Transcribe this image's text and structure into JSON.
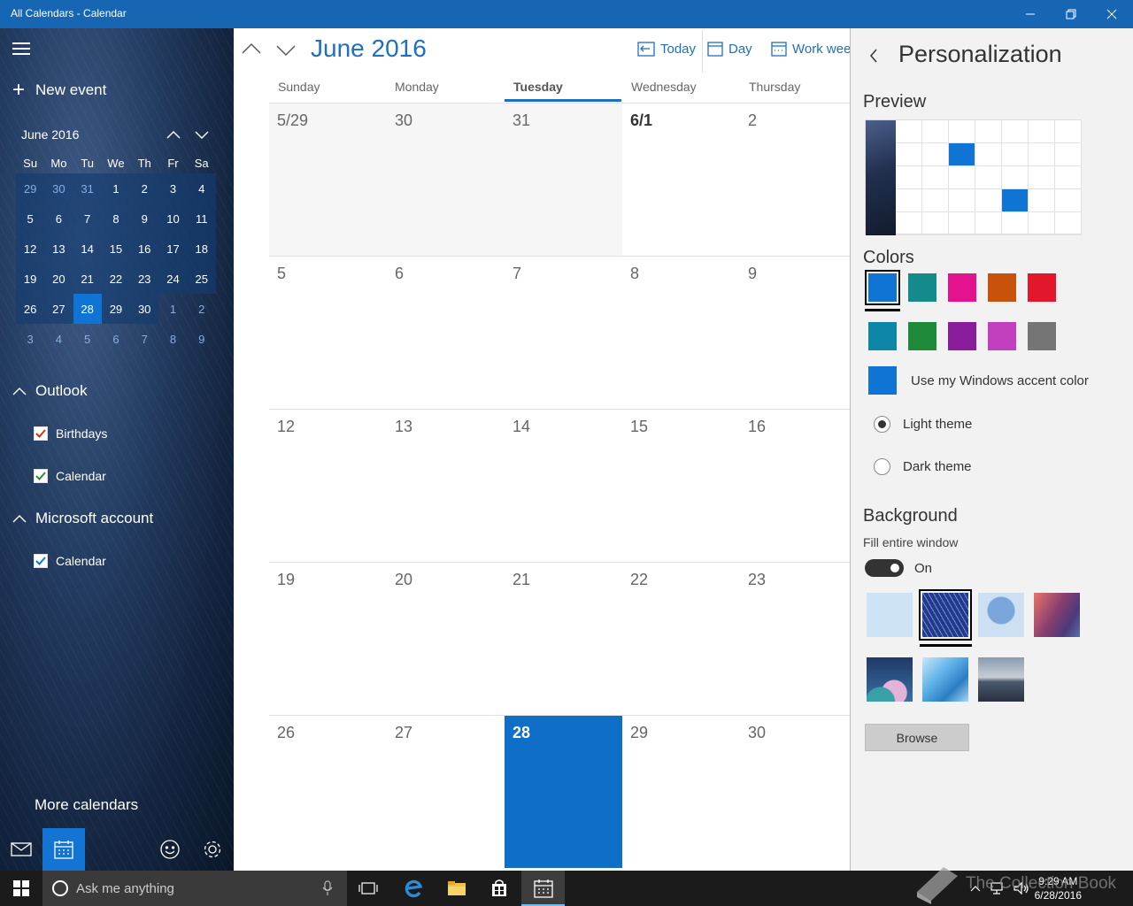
{
  "window": {
    "title": "All Calendars - Calendar"
  },
  "sidebar": {
    "new_event_label": "New event",
    "mini_calendar": {
      "title": "June 2016",
      "dow": [
        "Su",
        "Mo",
        "Tu",
        "We",
        "Th",
        "Fr",
        "Sa"
      ],
      "weeks": [
        [
          "29",
          "30",
          "31",
          "1",
          "2",
          "3",
          "4"
        ],
        [
          "5",
          "6",
          "7",
          "8",
          "9",
          "10",
          "11"
        ],
        [
          "12",
          "13",
          "14",
          "15",
          "16",
          "17",
          "18"
        ],
        [
          "19",
          "20",
          "21",
          "22",
          "23",
          "24",
          "25"
        ],
        [
          "26",
          "27",
          "28",
          "29",
          "30",
          "1",
          "2"
        ],
        [
          "3",
          "4",
          "5",
          "6",
          "7",
          "8",
          "9"
        ]
      ],
      "selected_day": "28"
    },
    "accounts": [
      {
        "name": "Outlook",
        "calendars": [
          {
            "label": "Birthdays",
            "color": "#c8361f"
          },
          {
            "label": "Calendar",
            "color": "#2f8a3a"
          }
        ]
      },
      {
        "name": "Microsoft account",
        "calendars": [
          {
            "label": "Calendar",
            "color": "#0f74d4"
          }
        ]
      }
    ],
    "more_calendars_label": "More calendars"
  },
  "main": {
    "month_title": "June 2016",
    "toolbar": {
      "today_label": "Today",
      "day_label": "Day",
      "work_week_label": "Work week"
    },
    "day_headers": [
      "Sunday",
      "Monday",
      "Tuesday",
      "Wednesday",
      "Thursday"
    ],
    "today_column": "Tuesday",
    "weeks": [
      [
        "5/29",
        "30",
        "31",
        "6/1",
        "2"
      ],
      [
        "5",
        "6",
        "7",
        "8",
        "9"
      ],
      [
        "12",
        "13",
        "14",
        "15",
        "16"
      ],
      [
        "19",
        "20",
        "21",
        "22",
        "23"
      ],
      [
        "26",
        "27",
        "28",
        "29",
        "30"
      ]
    ],
    "today_date": "28"
  },
  "panel": {
    "title": "Personalization",
    "preview_label": "Preview",
    "colors_label": "Colors",
    "colors": [
      "#0f74d4",
      "#148a8a",
      "#e3138f",
      "#c8510b",
      "#e3162c",
      "#0e86a8",
      "#1e8a3a",
      "#8a1d9c",
      "#c23fc0",
      "#757575"
    ],
    "selected_color": "#0f74d4",
    "accent_label": "Use my Windows accent color",
    "light_theme_label": "Light theme",
    "dark_theme_label": "Dark theme",
    "background_label": "Background",
    "fill_label": "Fill entire window",
    "toggle_state": "On",
    "browse_label": "Browse"
  },
  "taskbar": {
    "search_placeholder": "Ask me anything",
    "time": "9:29 AM",
    "date": "6/28/2016",
    "watermark": "The Collection Book"
  }
}
